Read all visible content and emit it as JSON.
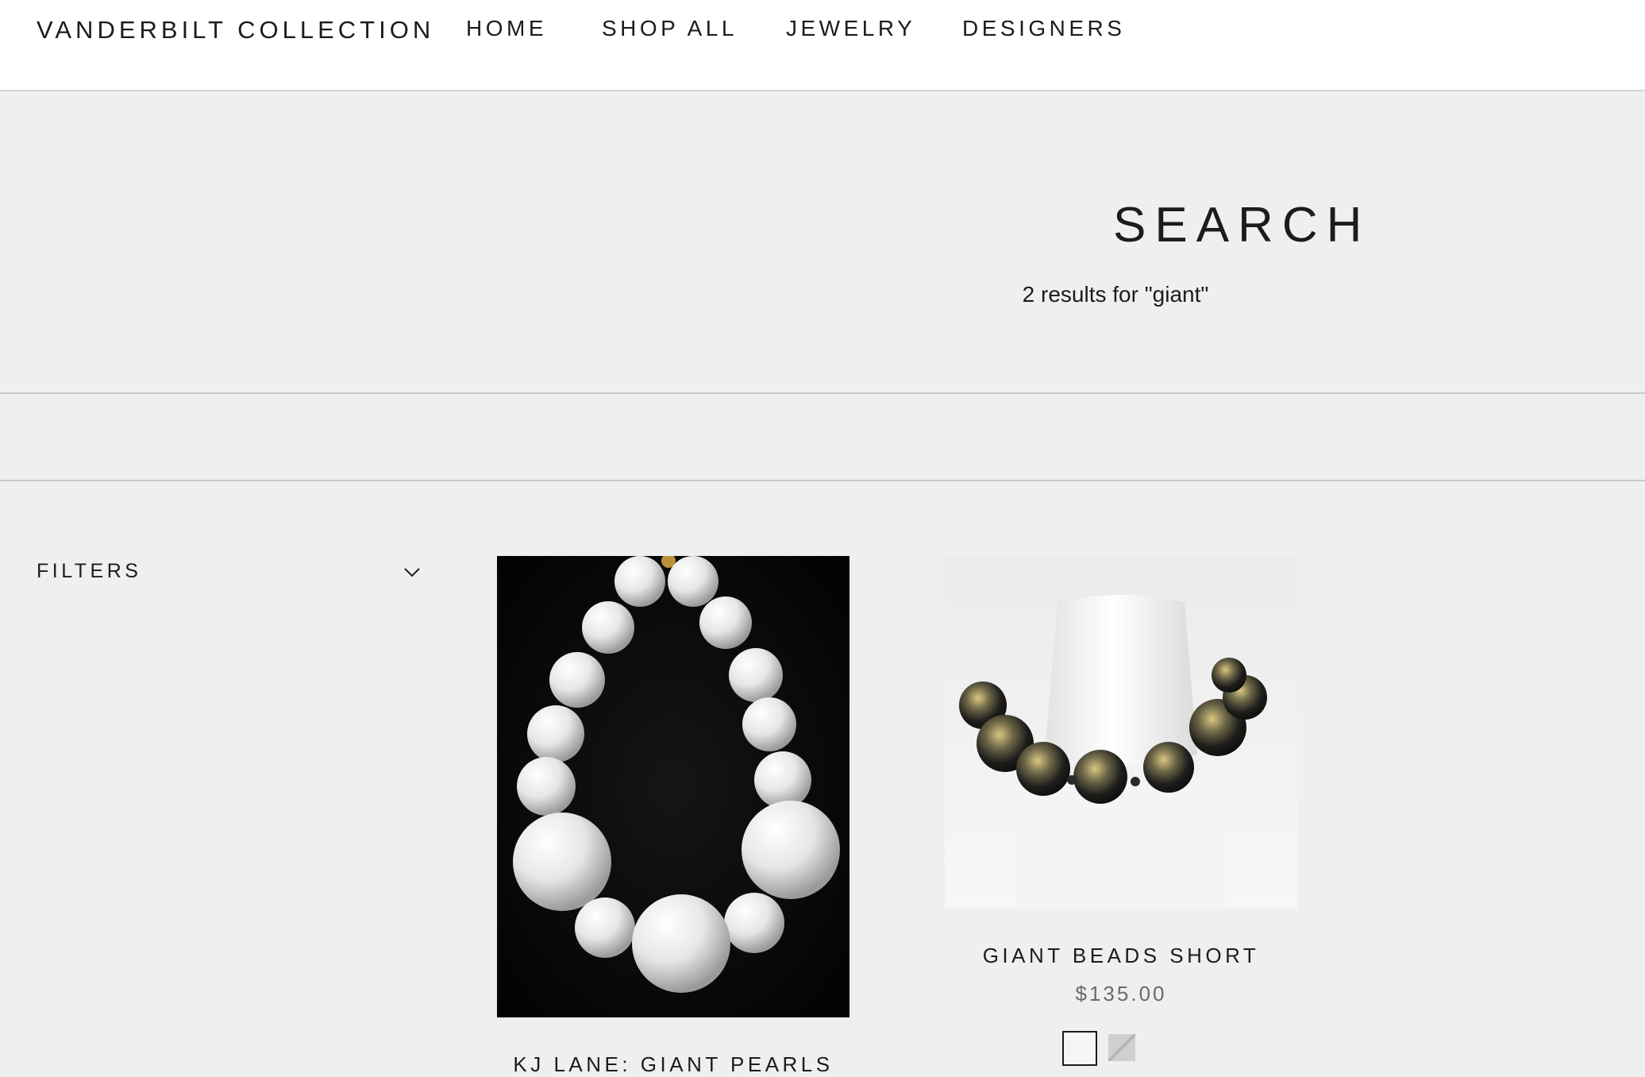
{
  "header": {
    "brand": "VANDERBILT COLLECTION",
    "nav": [
      "HOME",
      "SHOP ALL",
      "JEWELRY",
      "DESIGNERS"
    ]
  },
  "hero": {
    "title": "SEARCH",
    "results_text": "2 results for \"giant\""
  },
  "filters": {
    "label": "FILTERS",
    "icon": "chevron-down-icon"
  },
  "products": [
    {
      "title": "KJ LANE: GIANT PEARLS",
      "image": "white-pearl-necklace-on-black"
    },
    {
      "title": "GIANT BEADS SHORT",
      "price": "$135.00",
      "image": "black-gold-bead-necklace-on-white-bust",
      "swatches": [
        "white",
        "grey-pattern"
      ]
    }
  ],
  "colors": {
    "background": "#efefef",
    "header_bg": "#ffffff",
    "text": "#1c1c1c",
    "price": "#6a6a6a"
  }
}
